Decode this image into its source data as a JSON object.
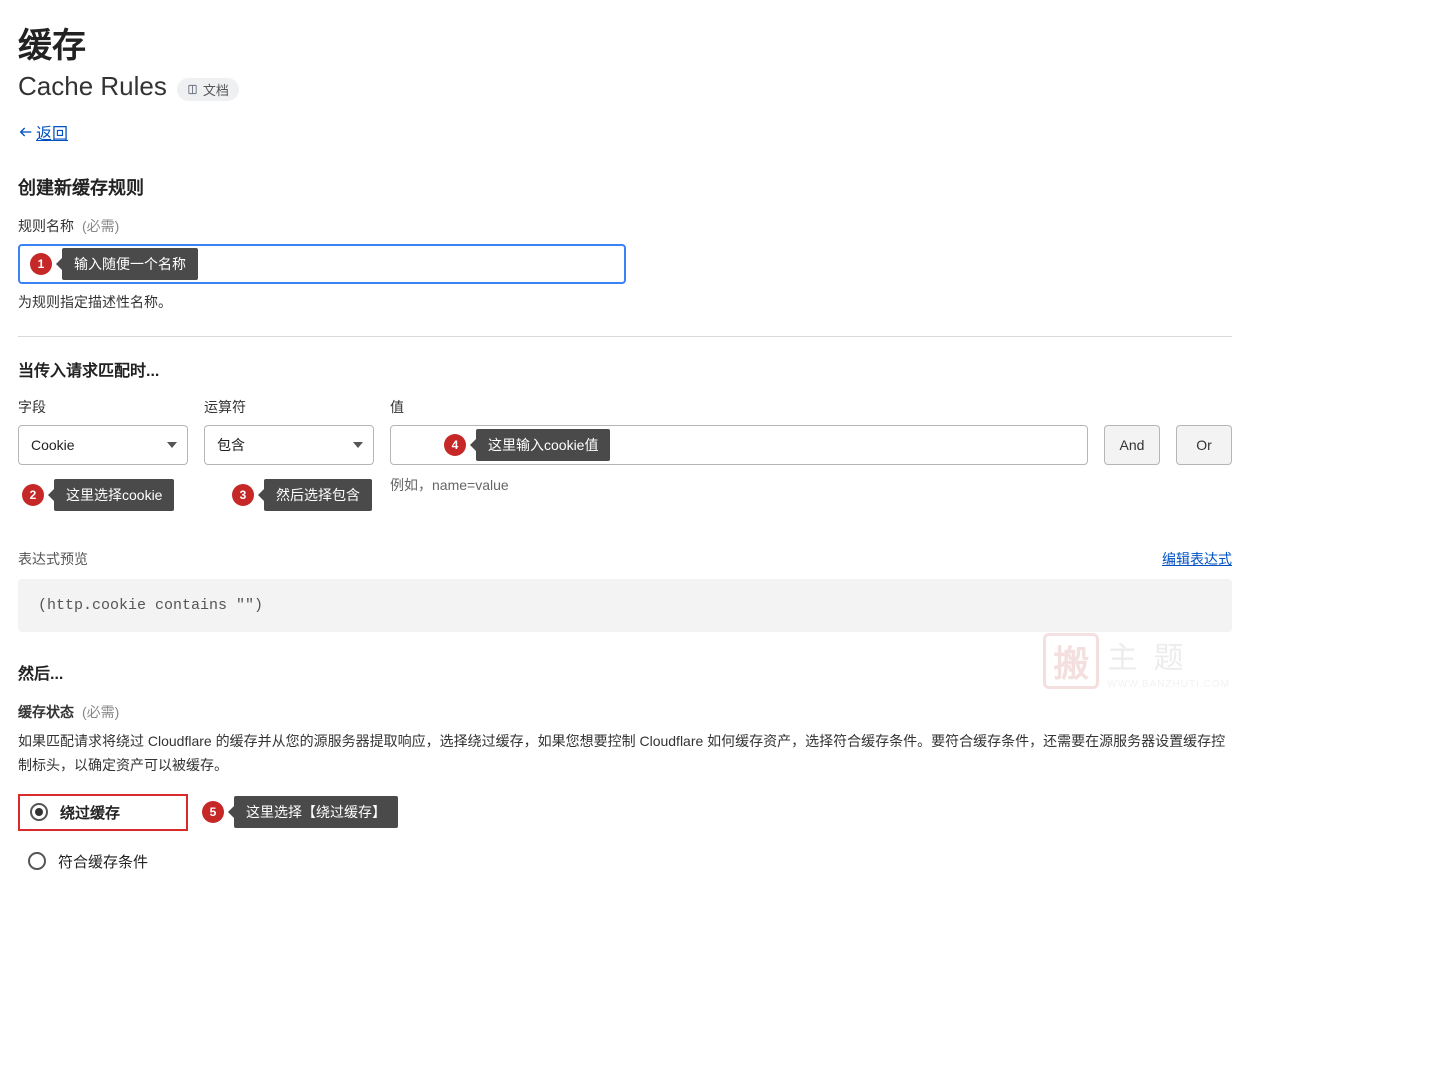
{
  "header": {
    "title": "缓存",
    "subtitle": "Cache Rules",
    "doc_label": "文档",
    "back_label": "返回"
  },
  "create": {
    "heading": "创建新缓存规则",
    "name_label": "规则名称",
    "required": "(必需)",
    "name_helper": "为规则指定描述性名称。"
  },
  "match": {
    "heading": "当传入请求匹配时...",
    "field_label": "字段",
    "operator_label": "运算符",
    "value_label": "值",
    "field_value": "Cookie",
    "operator_value": "包含",
    "example": "例如，name=value",
    "and": "And",
    "or": "Or"
  },
  "expr": {
    "preview_label": "表达式预览",
    "edit_label": "编辑表达式",
    "code": "(http.cookie contains \"\")"
  },
  "then": {
    "heading": "然后...",
    "status_label": "缓存状态",
    "required": "(必需)",
    "desc": "如果匹配请求将绕过 Cloudflare 的缓存并从您的源服务器提取响应，选择绕过缓存，如果您想要控制 Cloudflare 如何缓存资产，选择符合缓存条件。要符合缓存条件，还需要在源服务器设置缓存控制标头，以确定资产可以被缓存。",
    "opt_bypass": "绕过缓存",
    "opt_eligible": "符合缓存条件"
  },
  "annotations": {
    "a1": "输入随便一个名称",
    "a2": "这里选择cookie",
    "a3": "然后选择包含",
    "a4": "这里输入cookie值",
    "a5": "这里选择【绕过缓存】"
  },
  "watermark": {
    "char": "搬",
    "text": "主 题",
    "url": "WWW.BANZHUTI.COM"
  }
}
